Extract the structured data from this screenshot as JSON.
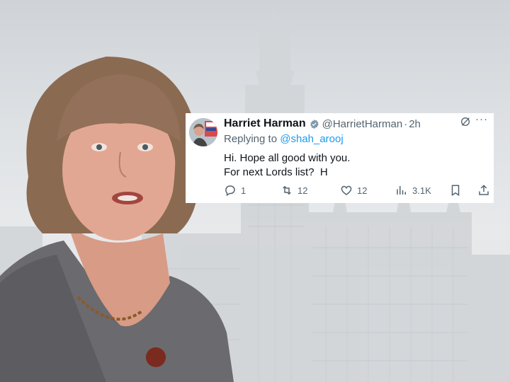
{
  "tweet": {
    "display_name": "Harriet Harman",
    "handle": "@HarrietHarman",
    "separator": "·",
    "time": "2h",
    "reply_prefix": "Replying to",
    "reply_to": "@shah_arooj",
    "text_line1": "Hi. Hope all good with you.",
    "text_line2": "For next Lords list?  H",
    "replies": "1",
    "reposts": "12",
    "likes": "12",
    "views": "3.1K",
    "more": "···"
  },
  "icons": {
    "verified": "verified-badge-icon",
    "grok": "grok-icon",
    "more": "more-icon",
    "reply": "reply-icon",
    "repost": "repost-icon",
    "like": "heart-icon",
    "views": "views-chart-icon",
    "bookmark": "bookmark-icon",
    "share": "share-icon"
  },
  "colors": {
    "text_primary": "#0f1419",
    "text_secondary": "#536471",
    "link": "#1d9bf0",
    "card_bg": "#ffffff"
  }
}
